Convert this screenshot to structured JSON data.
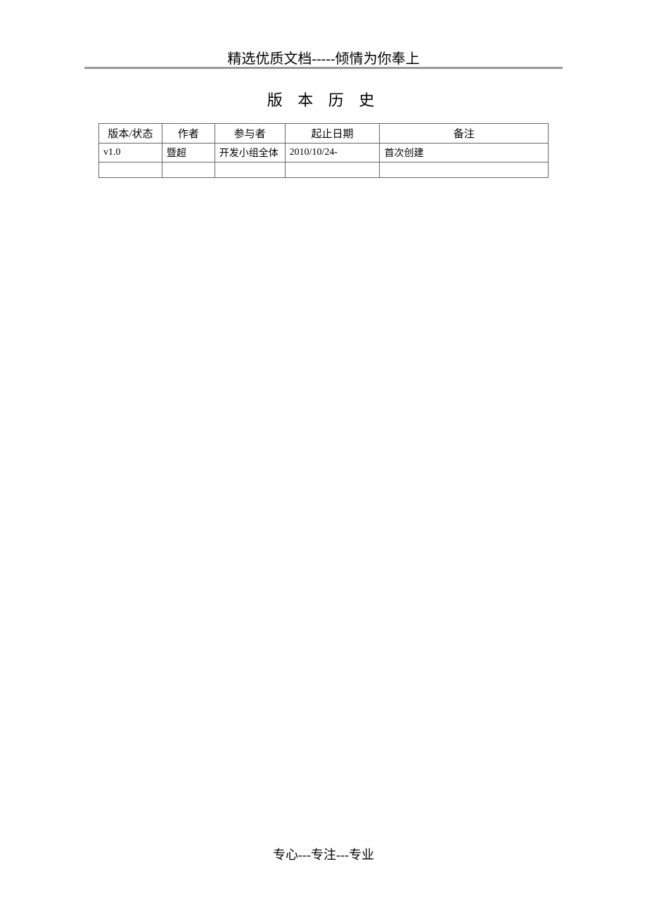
{
  "header": {
    "text": "精选优质文档-----倾情为你奉上"
  },
  "title": "版 本 历 史",
  "table": {
    "headers": {
      "version": "版本/状态",
      "author": "作者",
      "participant": "参与者",
      "date": "起止日期",
      "note": "备注"
    },
    "rows": [
      {
        "version": "v1.0",
        "author": "暨超",
        "participant": "开发小组全体",
        "date": "2010/10/24-",
        "note": "首次创建"
      },
      {
        "version": "",
        "author": "",
        "participant": "",
        "date": "",
        "note": ""
      }
    ]
  },
  "footer": {
    "text": "专心---专注---专业"
  }
}
